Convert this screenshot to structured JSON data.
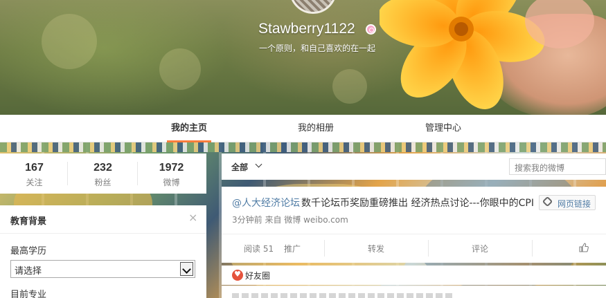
{
  "profile": {
    "username": "Stawberry1122",
    "bio": "一个原则，和自己喜欢的在一起"
  },
  "nav": {
    "tabs": [
      {
        "label": "我的主页",
        "active": true
      },
      {
        "label": "我的相册",
        "active": false
      },
      {
        "label": "管理中心",
        "active": false
      }
    ]
  },
  "stats": {
    "items": [
      {
        "value": "167",
        "label": "关注"
      },
      {
        "value": "232",
        "label": "粉丝"
      },
      {
        "value": "1972",
        "label": "微博"
      }
    ]
  },
  "education": {
    "title": "教育背景",
    "degree_label": "最高学历",
    "degree_value": "请选择",
    "major_label": "目前专业"
  },
  "feed": {
    "filter_label": "全部",
    "search_placeholder": "搜索我的微博",
    "post": {
      "author": "@人大经济论坛",
      "text": "数千论坛币奖励重磅推出 经济热点讨论---你眼中的CPI",
      "link_label": "网页链接",
      "meta": "3分钟前 来自 微博 weibo.com",
      "actions": {
        "read": "阅读 51",
        "promote": "推广",
        "repost": "转发",
        "comment": "评论"
      }
    },
    "friends_label": "好友圈"
  },
  "colors": {
    "accent": "#fa7d3c",
    "link": "#507ca5",
    "muted": "#808080"
  },
  "icons": [
    "gender-female-icon",
    "chevron-down-icon",
    "link-icon",
    "like-icon",
    "close-icon",
    "heart-icon"
  ]
}
